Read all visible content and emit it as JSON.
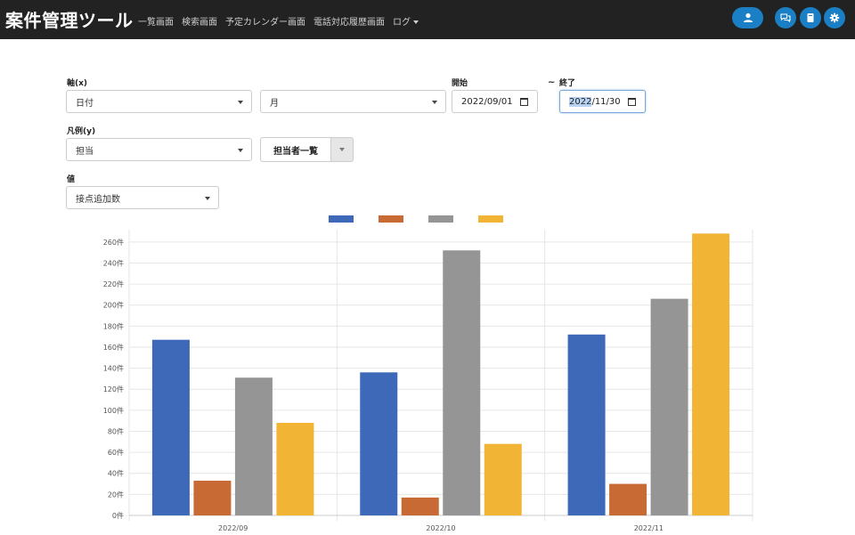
{
  "navbar": {
    "brand": "案件管理ツール",
    "links": [
      "一覧画面",
      "検索画面",
      "予定カレンダー画面",
      "電話対応履歴画面"
    ],
    "log_menu": "ログ",
    "icons": [
      "user-icon",
      "chat-icon",
      "book-icon",
      "gear-icon"
    ],
    "accent": "#1a7fc4"
  },
  "form": {
    "axis_x_label": "軸(x)",
    "axis_x_value": "日付",
    "axis_x_unit": "月",
    "start_label": "開始",
    "start_value": "2022/09/01",
    "range_sep": "~",
    "end_label": "終了",
    "end_value_selected": "2022",
    "end_value_rest": "/11/30",
    "legend_y_label": "凡例(y)",
    "legend_y_value": "担当",
    "staff_button": "担当者一覧",
    "value_label": "値",
    "value_value": "接点追加数"
  },
  "chart_data": {
    "type": "bar",
    "categories": [
      "2022/09",
      "2022/10",
      "2022/11"
    ],
    "series": [
      {
        "color": "#3e68b8",
        "values": [
          167,
          136,
          172
        ]
      },
      {
        "color": "#c86a34",
        "values": [
          33,
          17,
          30
        ]
      },
      {
        "color": "#959595",
        "values": [
          131,
          252,
          206
        ]
      },
      {
        "color": "#f1b435",
        "values": [
          88,
          68,
          268
        ]
      }
    ],
    "ylim": [
      0,
      270
    ],
    "yticks": [
      0,
      20,
      40,
      60,
      80,
      100,
      120,
      140,
      160,
      180,
      200,
      220,
      240,
      260
    ],
    "tick_suffix": "件",
    "legend": "top-center",
    "grid": true
  }
}
